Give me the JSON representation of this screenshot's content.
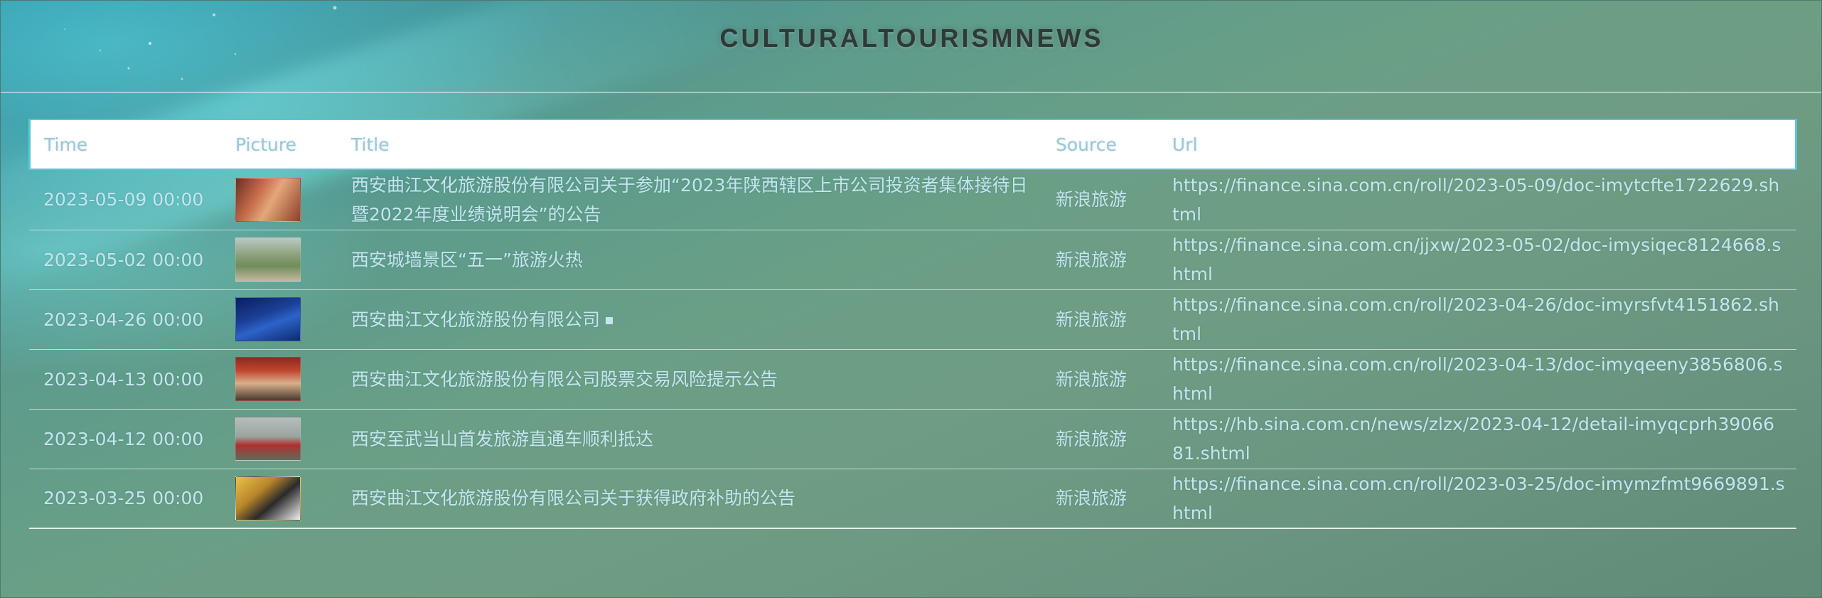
{
  "site": {
    "title": "CULTURALTOURISMNEWS"
  },
  "table": {
    "headers": {
      "time": "Time",
      "picture": "Picture",
      "title": "Title",
      "source": "Source",
      "url": "Url"
    },
    "rows": [
      {
        "time": "2023-05-09 00:00",
        "picture": "gold-coins-thumbnail",
        "title": "西安曲江文化旅游股份有限公司关于参加“2023年陕西辖区上市公司投资者集体接待日暨2022年度业绩说明会”的公告",
        "source": "新浪旅游",
        "url": "https://finance.sina.com.cn/roll/2023-05-09/doc-imytcfte1722629.shtml"
      },
      {
        "time": "2023-05-02 00:00",
        "picture": "city-wall-thumbnail",
        "title": "西安城墙景区“五一”旅游火热",
        "source": "新浪旅游",
        "url": "https://finance.sina.com.cn/jjxw/2023-05-02/doc-imysiqec8124668.shtml"
      },
      {
        "time": "2023-04-26 00:00",
        "picture": "stock-chart-thumbnail",
        "title": "西安曲江文化旅游股份有限公司",
        "title_icon": "square-icon",
        "source": "新浪旅游",
        "url": "https://finance.sina.com.cn/roll/2023-04-26/doc-imyrsfvt4151862.shtml"
      },
      {
        "time": "2023-04-13 00:00",
        "picture": "conference-thumbnail",
        "title": "西安曲江文化旅游股份有限公司股票交易风险提示公告",
        "source": "新浪旅游",
        "url": "https://finance.sina.com.cn/roll/2023-04-13/doc-imyqeeny3856806.shtml"
      },
      {
        "time": "2023-04-12 00:00",
        "picture": "group-photo-thumbnail",
        "title": "西安至武当山首发旅游直通车顺利抵达",
        "source": "新浪旅游",
        "url": "https://hb.sina.com.cn/news/zlzx/2023-04-12/detail-imyqcprh3906681.shtml"
      },
      {
        "time": "2023-03-25 00:00",
        "picture": "gold-bars-thumbnail",
        "title": "西安曲江文化旅游股份有限公司关于获得政府补助的公告",
        "source": "新浪旅游",
        "url": "https://finance.sina.com.cn/roll/2023-03-25/doc-imymzfmt9669891.shtml"
      }
    ]
  },
  "colors": {
    "header_text": "#9ac7d6",
    "cell_text": "#c3e6f0",
    "title_text": "#2f3a38",
    "header_border": "#58c6d5"
  }
}
